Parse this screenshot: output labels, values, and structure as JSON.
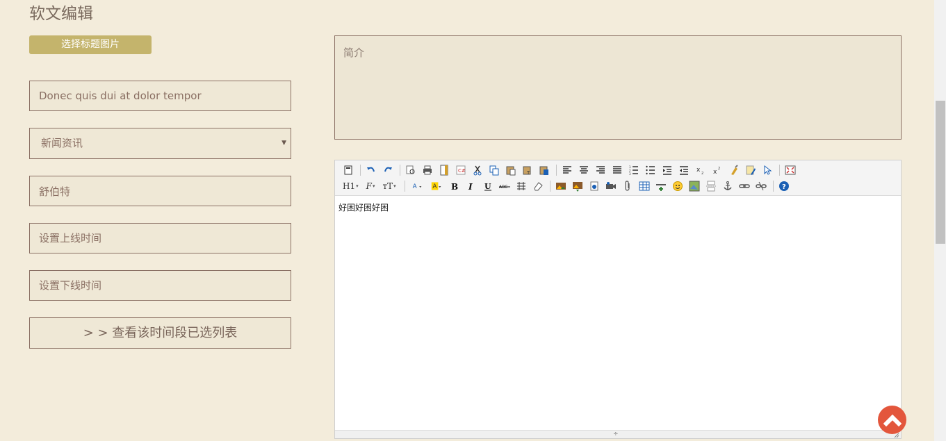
{
  "page": {
    "title": "软文编辑",
    "select_image_button": "选择标题图片",
    "title_input_value": "Donec quis dui at dolor tempor",
    "category_select_value": "新闻资讯",
    "author_input_value": "舒伯特",
    "online_time_placeholder": "设置上线时间",
    "offline_time_placeholder": "设置下线时间",
    "view_list_button": "> > 查看该时间段已选列表",
    "summary_placeholder": "简介"
  },
  "editor": {
    "content": "好困好困好困",
    "toolbar_row1": [
      "source-icon",
      "undo-icon",
      "redo-icon",
      "preview-icon",
      "print-icon",
      "template-icon",
      "code-icon",
      "cut-icon",
      "copy-icon",
      "paste-icon",
      "paste-text-icon",
      "paste-word-icon",
      "align-left-icon",
      "align-center-icon",
      "align-right-icon",
      "align-justify-icon",
      "ordered-list-icon",
      "unordered-list-icon",
      "indent-icon",
      "outdent-icon",
      "subscript-icon",
      "superscript-icon",
      "clear-format-icon",
      "quick-format-icon",
      "select-all-icon",
      "fullscreen-icon"
    ],
    "toolbar_row2": [
      "heading-combo",
      "font-family-combo",
      "font-size-combo",
      "font-color-icon",
      "highlight-icon",
      "bold-icon",
      "italic-icon",
      "underline-icon",
      "strikethrough-icon",
      "line-height-icon",
      "remove-format-icon",
      "image-icon",
      "multi-image-icon",
      "flash-icon",
      "media-icon",
      "attachment-icon",
      "table-icon",
      "hr-icon",
      "emoticon-icon",
      "baidu-map-icon",
      "page-break-icon",
      "anchor-icon",
      "link-icon",
      "unlink-icon",
      "about-icon"
    ],
    "combo_labels": {
      "heading": "H1",
      "font_family": "F",
      "font_size": "тT"
    }
  },
  "colors": {
    "background": "#f3ecdb",
    "accent_button": "#c4b46c",
    "border": "#8a6f63",
    "back_to_top": "#e3563c"
  }
}
